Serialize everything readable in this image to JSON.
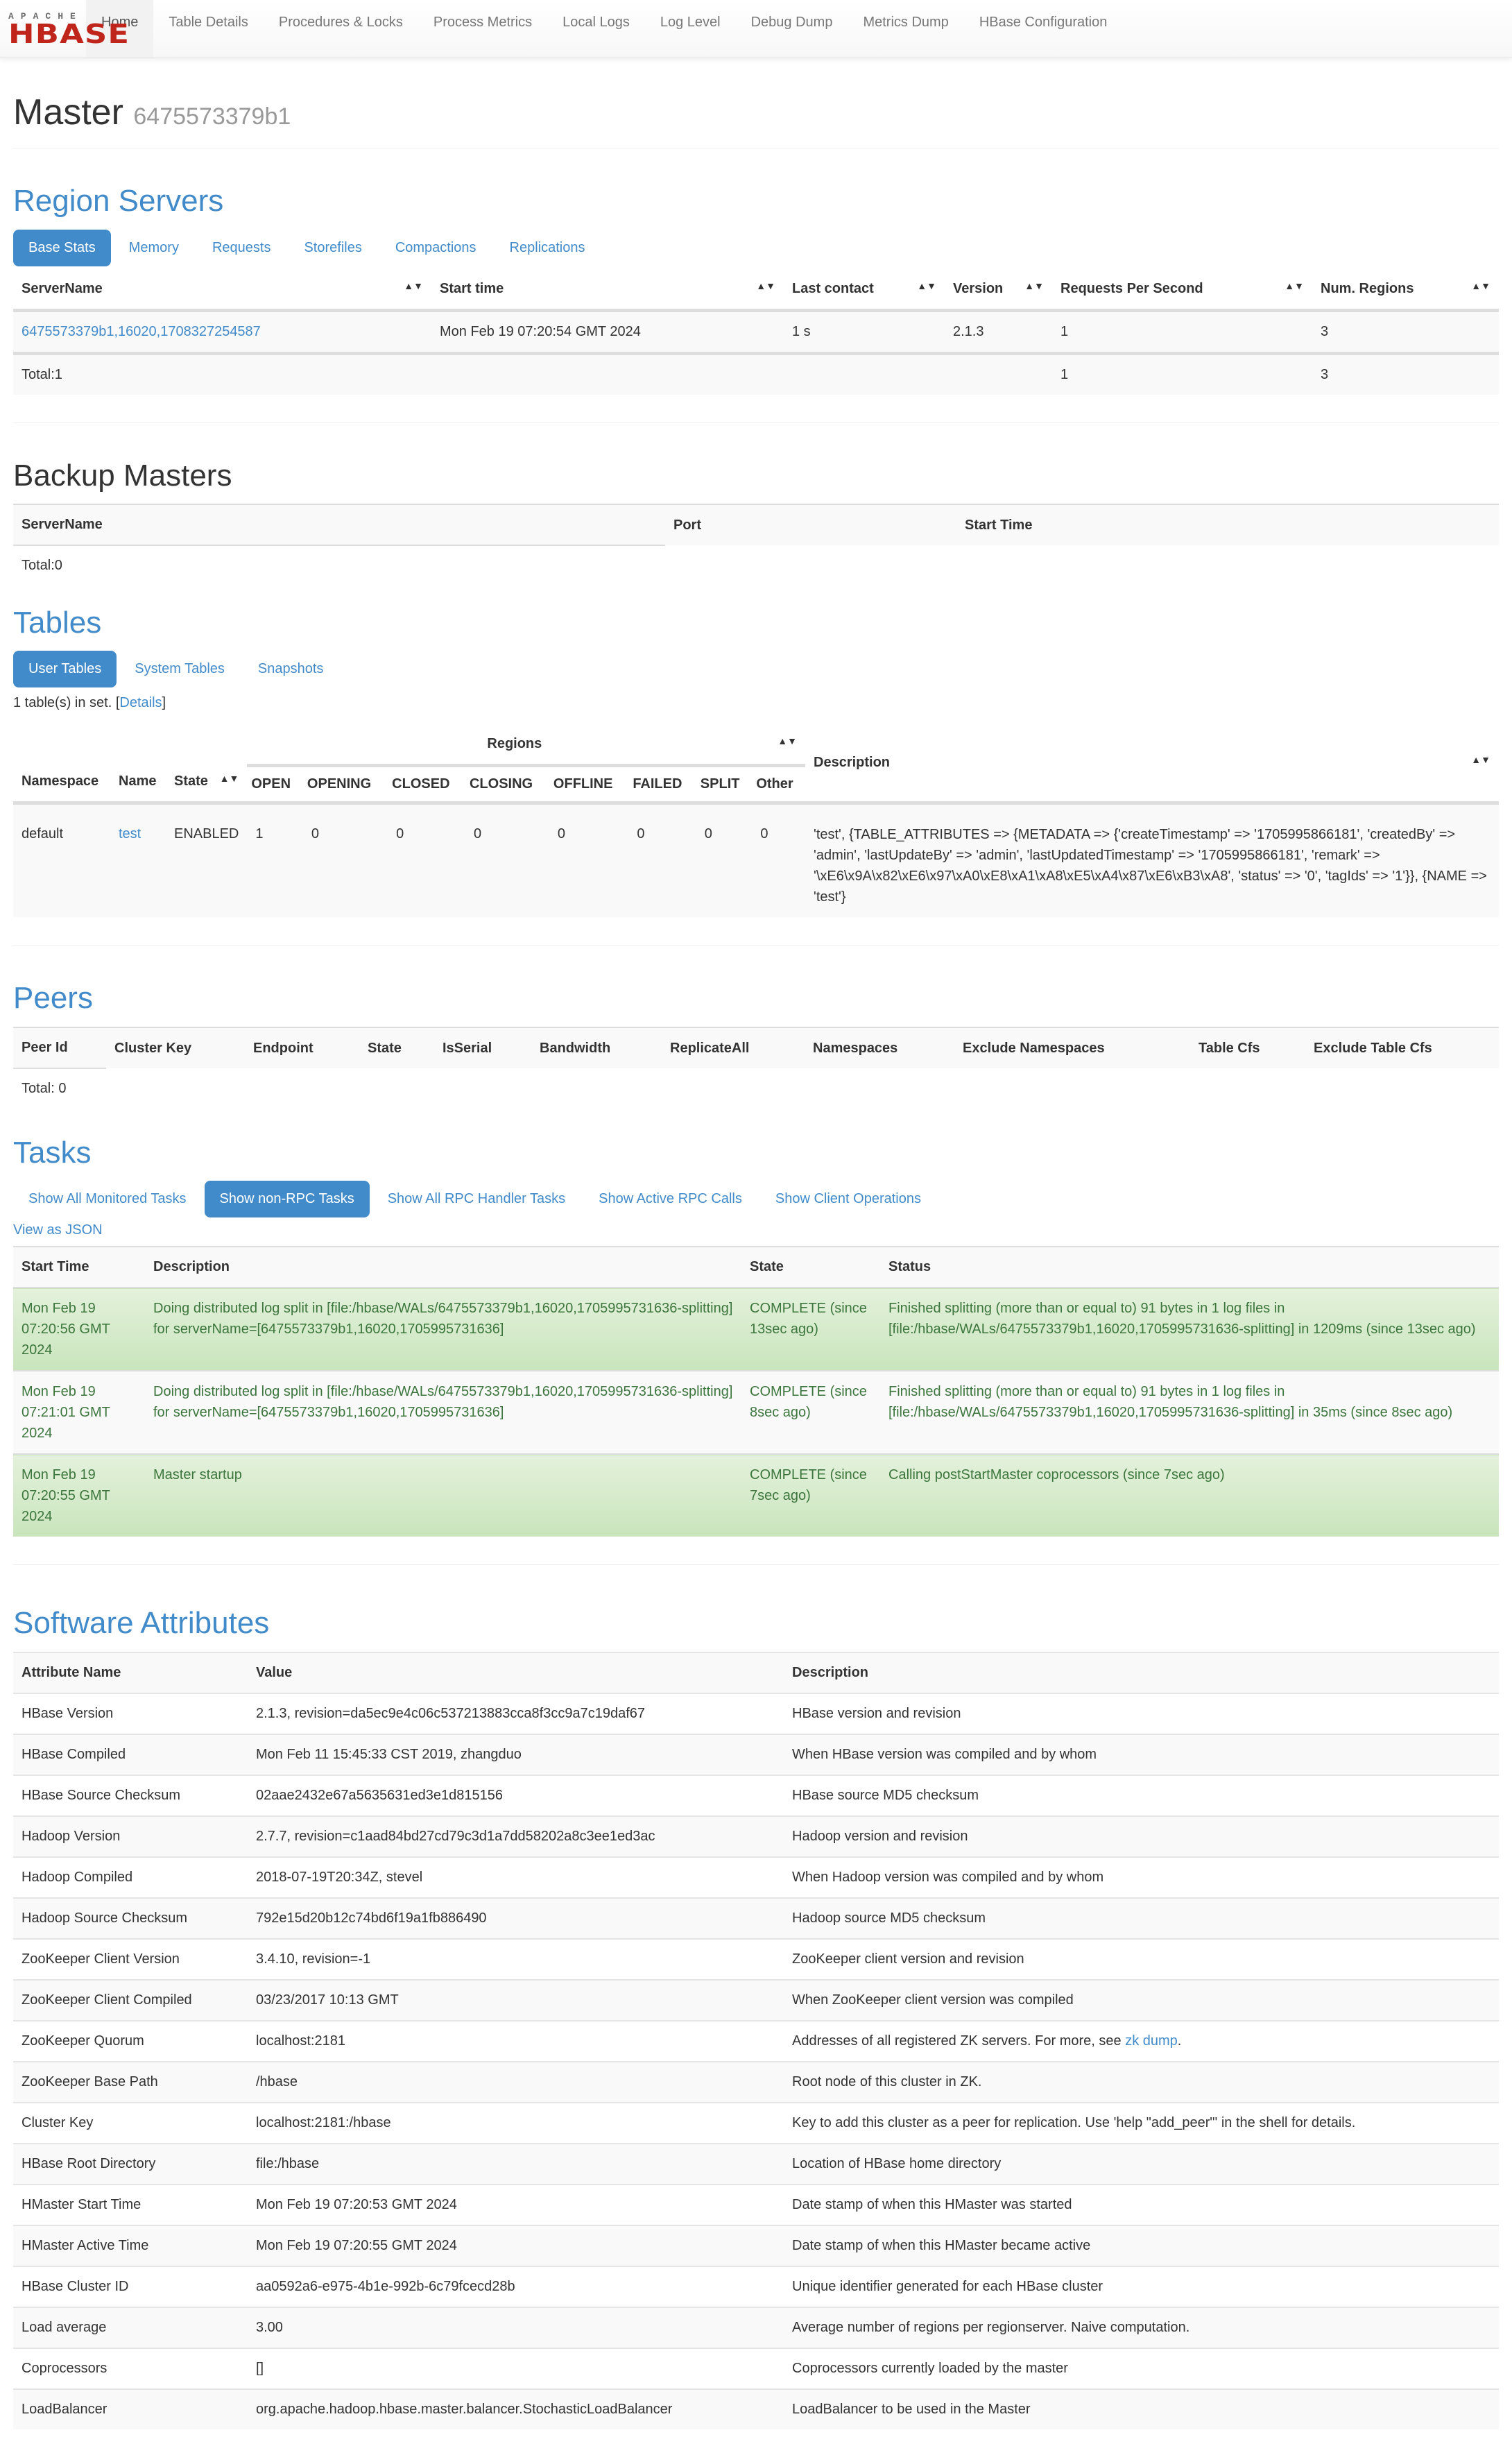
{
  "navbar": {
    "logo_top": "APACHE",
    "logo_main": "HBASE",
    "items": [
      {
        "label": "Home",
        "active": true
      },
      {
        "label": "Table Details"
      },
      {
        "label": "Procedures & Locks"
      },
      {
        "label": "Process Metrics"
      },
      {
        "label": "Local Logs"
      },
      {
        "label": "Log Level"
      },
      {
        "label": "Debug Dump"
      },
      {
        "label": "Metrics Dump"
      },
      {
        "label": "HBase Configuration"
      }
    ]
  },
  "header": {
    "title": "Master",
    "subtitle": "6475573379b1"
  },
  "region_servers": {
    "title": "Region Servers",
    "tabs": [
      "Base Stats",
      "Memory",
      "Requests",
      "Storefiles",
      "Compactions",
      "Replications"
    ],
    "active_tab": "Base Stats",
    "columns": [
      "ServerName",
      "Start time",
      "Last contact",
      "Version",
      "Requests Per Second",
      "Num. Regions"
    ],
    "rows": [
      {
        "server": "6475573379b1,16020,1708327254587",
        "start": "Mon Feb 19 07:20:54 GMT 2024",
        "last_contact": "1 s",
        "version": "2.1.3",
        "rps": "1",
        "regions": "3"
      }
    ],
    "total": {
      "label": "Total:1",
      "rps": "1",
      "regions": "3"
    }
  },
  "backup_masters": {
    "title": "Backup Masters",
    "columns": [
      "ServerName",
      "Port",
      "Start Time"
    ],
    "total": "Total:0"
  },
  "tables": {
    "title": "Tables",
    "tabs": [
      "User Tables",
      "System Tables",
      "Snapshots"
    ],
    "active_tab": "User Tables",
    "summary_prefix": "1 table(s) in set. [",
    "details_link": "Details",
    "summary_suffix": "]",
    "columns": {
      "namespace": "Namespace",
      "name": "Name",
      "state": "State",
      "regions": "Regions",
      "region_states": [
        "OPEN",
        "OPENING",
        "CLOSED",
        "CLOSING",
        "OFFLINE",
        "FAILED",
        "SPLIT",
        "Other"
      ],
      "description": "Description"
    },
    "rows": [
      {
        "namespace": "default",
        "name": "test",
        "state": "ENABLED",
        "counts": [
          "1",
          "0",
          "0",
          "0",
          "0",
          "0",
          "0",
          "0"
        ],
        "description": "'test', {TABLE_ATTRIBUTES => {METADATA => {'createTimestamp' => '1705995866181', 'createdBy' => 'admin', 'lastUpdateBy' => 'admin', 'lastUpdatedTimestamp' => '1705995866181', 'remark' => '\\xE6\\x9A\\x82\\xE6\\x97\\xA0\\xE8\\xA1\\xA8\\xE5\\xA4\\x87\\xE6\\xB3\\xA8', 'status' => '0', 'tagIds' => '1'}}, {NAME => 'test'}"
      }
    ]
  },
  "peers": {
    "title": "Peers",
    "columns": [
      "Peer Id",
      "Cluster Key",
      "Endpoint",
      "State",
      "IsSerial",
      "Bandwidth",
      "ReplicateAll",
      "Namespaces",
      "Exclude Namespaces",
      "Table Cfs",
      "Exclude Table Cfs"
    ],
    "total": "Total: 0"
  },
  "tasks": {
    "title": "Tasks",
    "tabs": [
      "Show All Monitored Tasks",
      "Show non-RPC Tasks",
      "Show All RPC Handler Tasks",
      "Show Active RPC Calls",
      "Show Client Operations"
    ],
    "active_tab": "Show non-RPC Tasks",
    "json_link": "View as JSON",
    "columns": [
      "Start Time",
      "Description",
      "State",
      "Status"
    ],
    "rows": [
      {
        "start": "Mon Feb 19 07:20:56 GMT 2024",
        "description": "Doing distributed log split in [file:/hbase/WALs/6475573379b1,16020,1705995731636-splitting] for serverName=[6475573379b1,16020,1705995731636]",
        "state": "COMPLETE (since 13sec ago)",
        "status": "Finished splitting (more than or equal to) 91 bytes in 1 log files in [file:/hbase/WALs/6475573379b1,16020,1705995731636-splitting] in 1209ms (since 13sec ago)",
        "style": "green"
      },
      {
        "start": "Mon Feb 19 07:21:01 GMT 2024",
        "description": "Doing distributed log split in [file:/hbase/WALs/6475573379b1,16020,1705995731636-splitting] for serverName=[6475573379b1,16020,1705995731636]",
        "state": "COMPLETE (since 8sec ago)",
        "status": "Finished splitting (more than or equal to) 91 bytes in 1 log files in [file:/hbase/WALs/6475573379b1,16020,1705995731636-splitting] in 35ms (since 8sec ago)",
        "style": "white"
      },
      {
        "start": "Mon Feb 19 07:20:55 GMT 2024",
        "description": "Master startup",
        "state": "COMPLETE (since 7sec ago)",
        "status": "Calling postStartMaster coprocessors (since 7sec ago)",
        "style": "green"
      }
    ]
  },
  "software_attributes": {
    "title": "Software Attributes",
    "columns": [
      "Attribute Name",
      "Value",
      "Description"
    ],
    "rows": [
      {
        "name": "HBase Version",
        "value": "2.1.3, revision=da5ec9e4c06c537213883cca8f3cc9a7c19daf67",
        "description": "HBase version and revision"
      },
      {
        "name": "HBase Compiled",
        "value": "Mon Feb 11 15:45:33 CST 2019, zhangduo",
        "description": "When HBase version was compiled and by whom"
      },
      {
        "name": "HBase Source Checksum",
        "value": "02aae2432e67a5635631ed3e1d815156",
        "description": "HBase source MD5 checksum"
      },
      {
        "name": "Hadoop Version",
        "value": "2.7.7, revision=c1aad84bd27cd79c3d1a7dd58202a8c3ee1ed3ac",
        "description": "Hadoop version and revision"
      },
      {
        "name": "Hadoop Compiled",
        "value": "2018-07-19T20:34Z, stevel",
        "description": "When Hadoop version was compiled and by whom"
      },
      {
        "name": "Hadoop Source Checksum",
        "value": "792e15d20b12c74bd6f19a1fb886490",
        "description": "Hadoop source MD5 checksum"
      },
      {
        "name": "ZooKeeper Client Version",
        "value": "3.4.10, revision=-1",
        "description": "ZooKeeper client version and revision"
      },
      {
        "name": "ZooKeeper Client Compiled",
        "value": "03/23/2017 10:13 GMT",
        "description": "When ZooKeeper client version was compiled"
      },
      {
        "name": "ZooKeeper Quorum",
        "value": "localhost:2181",
        "description": "Addresses of all registered ZK servers. For more, see ",
        "link": "zk dump",
        "description_suffix": "."
      },
      {
        "name": "ZooKeeper Base Path",
        "value": "/hbase",
        "description": "Root node of this cluster in ZK."
      },
      {
        "name": "Cluster Key",
        "value": "localhost:2181:/hbase",
        "description": "Key to add this cluster as a peer for replication. Use 'help \"add_peer\"' in the shell for details."
      },
      {
        "name": "HBase Root Directory",
        "value": "file:/hbase",
        "description": "Location of HBase home directory"
      },
      {
        "name": "HMaster Start Time",
        "value": "Mon Feb 19 07:20:53 GMT 2024",
        "description": "Date stamp of when this HMaster was started"
      },
      {
        "name": "HMaster Active Time",
        "value": "Mon Feb 19 07:20:55 GMT 2024",
        "description": "Date stamp of when this HMaster became active"
      },
      {
        "name": "HBase Cluster ID",
        "value": "aa0592a6-e975-4b1e-992b-6c79fcecd28b",
        "description": "Unique identifier generated for each HBase cluster"
      },
      {
        "name": "Load average",
        "value": "3.00",
        "description": "Average number of regions per regionserver. Naive computation."
      },
      {
        "name": "Coprocessors",
        "value": "[]",
        "description": "Coprocessors currently loaded by the master"
      },
      {
        "name": "LoadBalancer",
        "value": "org.apache.hadoop.hbase.master.balancer.StochasticLoadBalancer",
        "description": "LoadBalancer to be used in the Master"
      }
    ]
  }
}
